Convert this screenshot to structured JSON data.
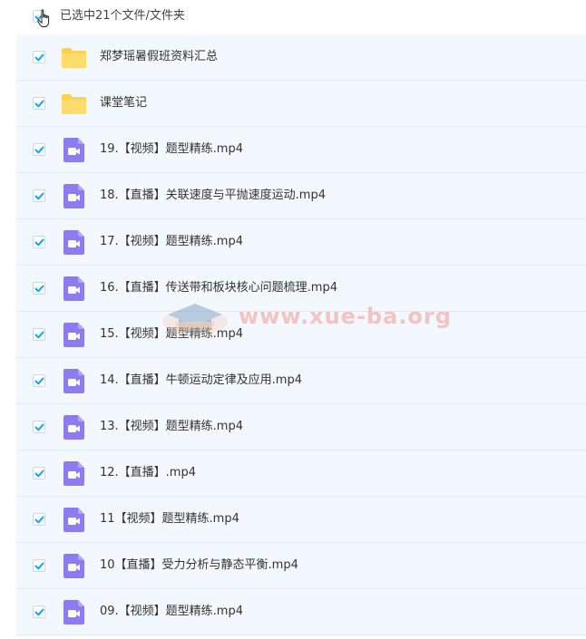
{
  "header": {
    "selected_count": "已选中21个文件/文件夹",
    "select_all_checked": true
  },
  "colors": {
    "checkbox_check": "#06a7ff",
    "folder": "#ffd04d",
    "video_icon": "#8c7cf0",
    "row_bg": "#f2f8fd",
    "watermark": "#f29a91"
  },
  "files": [
    {
      "name": "郑梦瑶暑假班资料汇总",
      "icon": "folder-icon",
      "checked": true
    },
    {
      "name": "课堂笔记",
      "icon": "folder-icon",
      "checked": true
    },
    {
      "name": "19.【视频】题型精练.mp4",
      "icon": "video-file-icon",
      "checked": true
    },
    {
      "name": "18.【直播】关联速度与平抛速度运动.mp4",
      "icon": "video-file-icon",
      "checked": true
    },
    {
      "name": "17.【视频】题型精练.mp4",
      "icon": "video-file-icon",
      "checked": true
    },
    {
      "name": "16.【直播】传送带和板块核心问题梳理.mp4",
      "icon": "video-file-icon",
      "checked": true
    },
    {
      "name": "15.【视频】题型精练.mp4",
      "icon": "video-file-icon",
      "checked": true
    },
    {
      "name": "14.【直播】牛顿运动定律及应用.mp4",
      "icon": "video-file-icon",
      "checked": true
    },
    {
      "name": "13.【视频】题型精练.mp4",
      "icon": "video-file-icon",
      "checked": true
    },
    {
      "name": "12.【直播】.mp4",
      "icon": "video-file-icon",
      "checked": true
    },
    {
      "name": "11【视频】题型精练.mp4",
      "icon": "video-file-icon",
      "checked": true
    },
    {
      "name": "10【直播】受力分析与静态平衡.mp4",
      "icon": "video-file-icon",
      "checked": true
    },
    {
      "name": "09.【视频】题型精练.mp4",
      "icon": "video-file-icon",
      "checked": true
    }
  ],
  "watermark": {
    "text": "www.xue-ba.org",
    "icon": "graduation-cap-icon"
  }
}
